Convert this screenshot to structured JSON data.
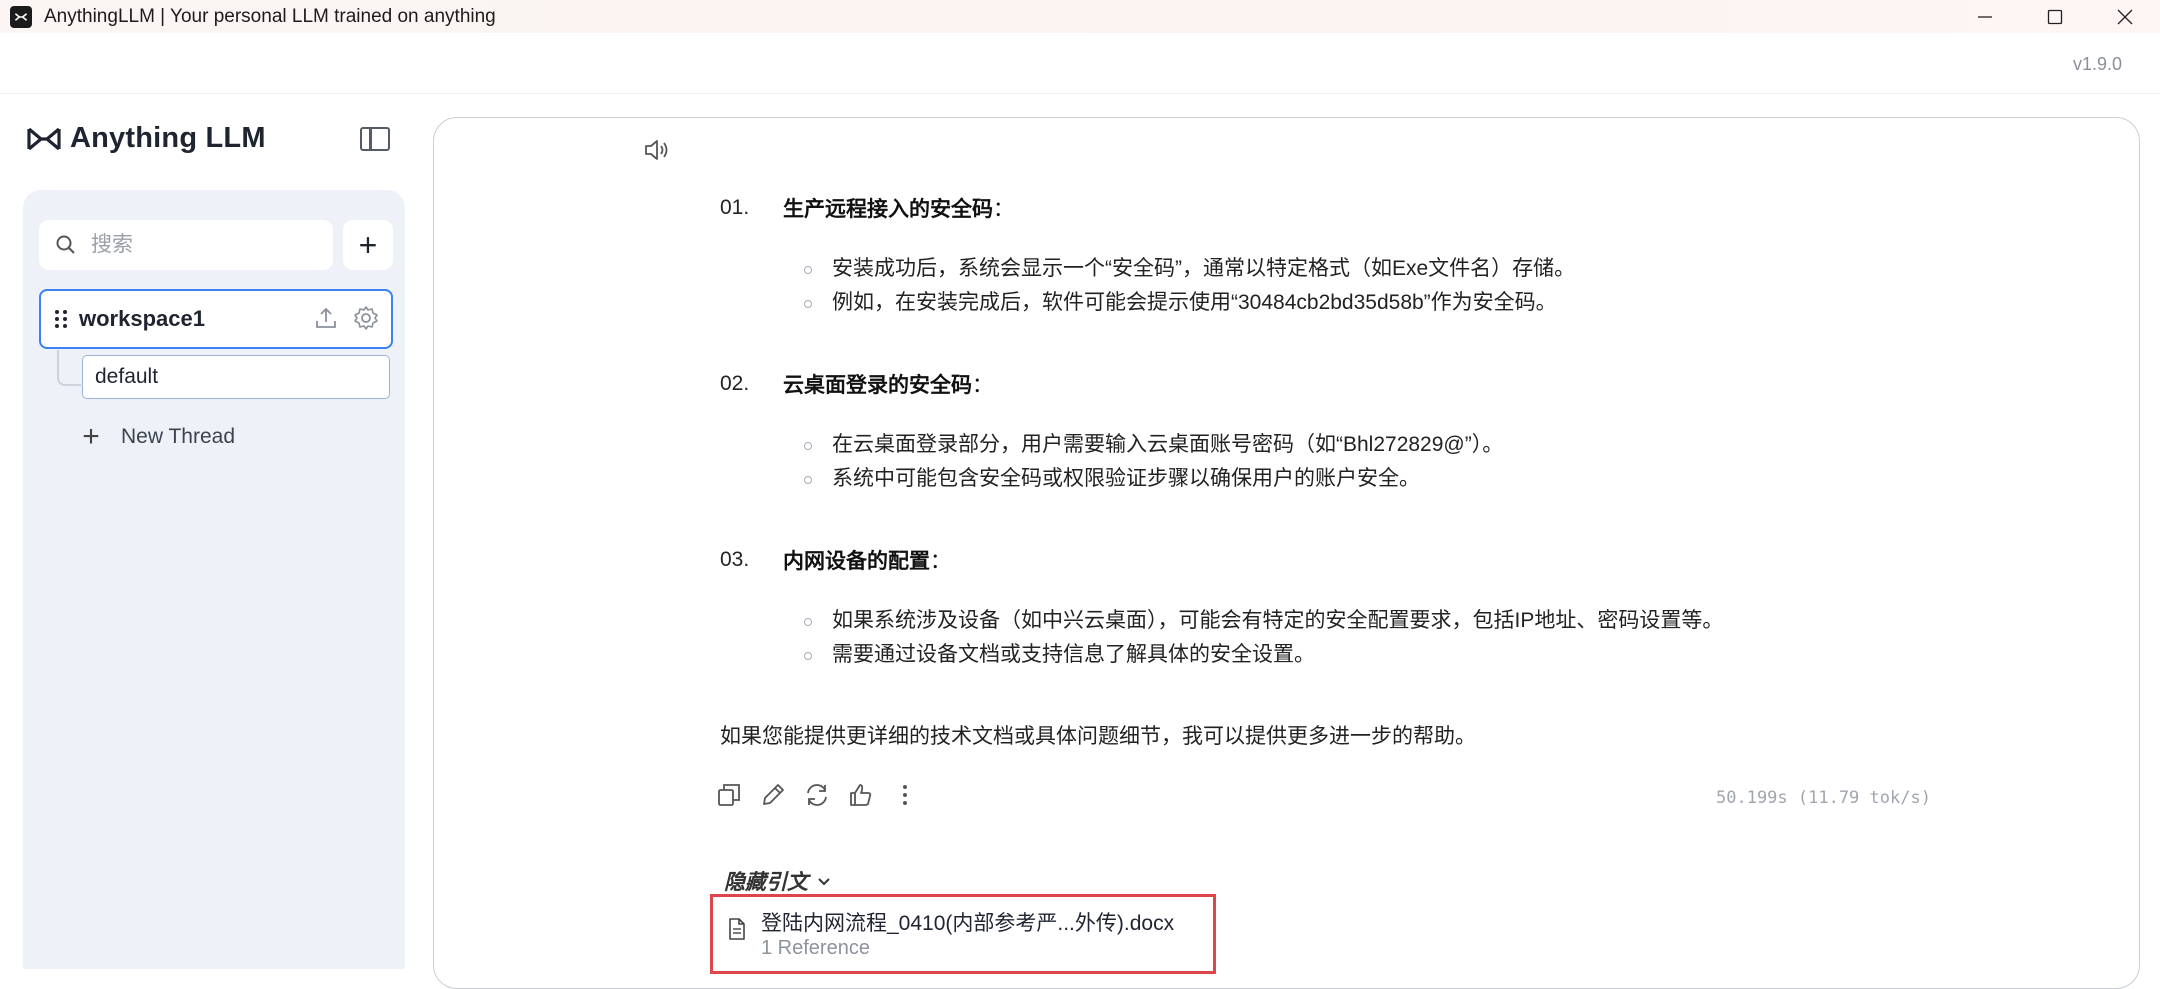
{
  "window": {
    "title": "AnythingLLM | Your personal LLM trained on anything",
    "controls": [
      "minimize",
      "maximize",
      "close"
    ]
  },
  "header": {
    "version": "v1.9.0"
  },
  "sidebar": {
    "brand": "Anything LLM",
    "search": {
      "placeholder": "搜索",
      "value": ""
    },
    "add_label": "+",
    "workspace": {
      "label": "workspace1"
    },
    "threads": [
      {
        "label": "default"
      }
    ],
    "new_thread_label": "New Thread"
  },
  "chat": {
    "sections": [
      {
        "num": "01.",
        "title": "生产远程接入的安全码",
        "colon": "：",
        "bullets": [
          "安装成功后，系统会显示一个“安全码”，通常以特定格式（如Exe文件名）存储。",
          "例如，在安装完成后，软件可能会提示使用“30484cb2bd35d58b”作为安全码。"
        ]
      },
      {
        "num": "02.",
        "title": "云桌面登录的安全码",
        "colon": "：",
        "bullets": [
          "在云桌面登录部分，用户需要输入云桌面账号密码（如“Bhl272829@”）。",
          "系统中可能包含安全码或权限验证步骤以确保用户的账户安全。"
        ]
      },
      {
        "num": "03.",
        "title": "内网设备的配置",
        "colon": "：",
        "bullets": [
          "如果系统涉及设备（如中兴云桌面），可能会有特定的安全配置要求，包括IP地址、密码设置等。",
          "需要通过设备文档或支持信息了解具体的安全设置。"
        ]
      }
    ],
    "closing": "如果您能提供更详细的技术文档或具体问题细节，我可以提供更多进一步的帮助。",
    "stats": "50.199s (11.79 tok/s)",
    "citations_toggle": "隐藏引文",
    "citation": {
      "name": "登陆内网流程_0410(内部参考严...外传).docx",
      "refs": "1 Reference"
    },
    "highlight_color": "#e0454b"
  }
}
